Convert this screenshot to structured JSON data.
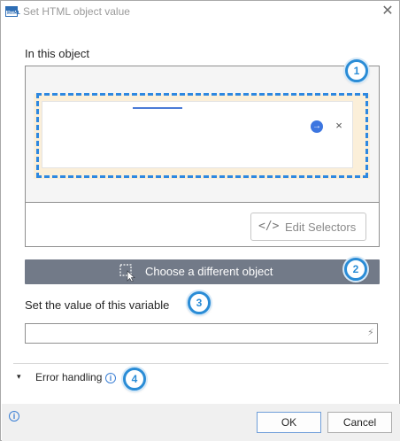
{
  "window": {
    "title": "Set HTML object value",
    "icon_name": "html-icon",
    "icon_text": "HTML",
    "close_glyph": "✕"
  },
  "object_section": {
    "label": "In this object",
    "preview": {
      "go_glyph": "→",
      "close_glyph": "×"
    },
    "edit_selectors": {
      "icon_glyph": "</>",
      "label": "Edit Selectors"
    }
  },
  "choose_button": {
    "label": "Choose a different object",
    "icon_name": "selection-cursor-icon"
  },
  "variable_section": {
    "label": "Set the value of this variable",
    "value": "",
    "flash_glyph": "⚡"
  },
  "error_handling": {
    "chevron_glyph": "▾",
    "label": "Error handling",
    "info_glyph": "i"
  },
  "footer": {
    "info_glyph": "i",
    "ok_label": "OK",
    "cancel_label": "Cancel"
  },
  "badges": [
    "1",
    "2",
    "3",
    "4"
  ],
  "colors": {
    "accent": "#2a8cd6",
    "choose_button_bg": "#727a88",
    "selection_dash": "#2e88e0",
    "highlight_glow": "#fbefd9"
  }
}
